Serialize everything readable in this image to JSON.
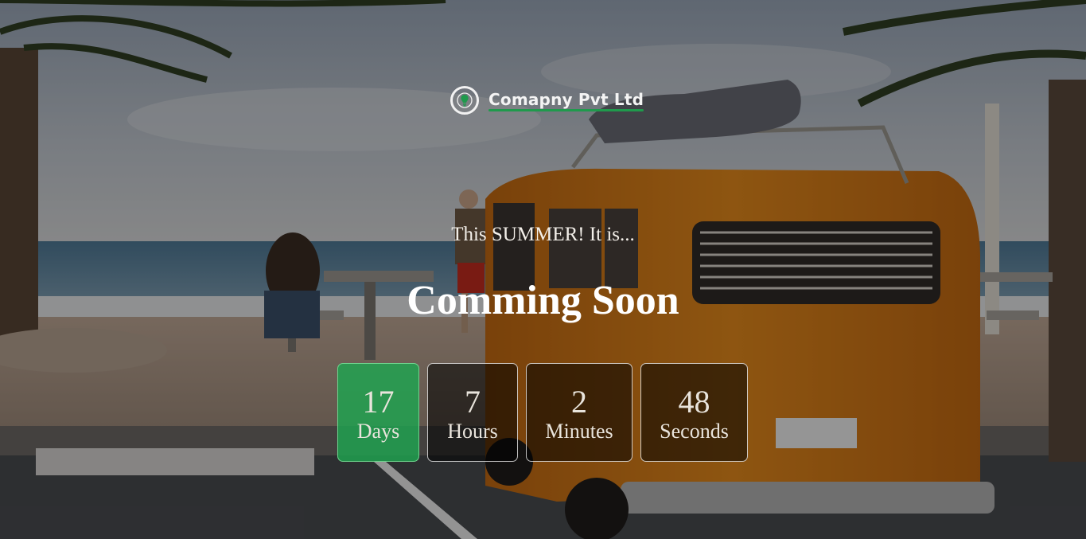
{
  "brand": {
    "name": "Comapny Pvt Ltd",
    "logo_icon": "lightbulb-icon",
    "accent_color": "#1f9a4c"
  },
  "hero": {
    "tagline": "This SUMMER! It is...",
    "headline": "Comming Soon"
  },
  "countdown": {
    "days": {
      "value": "17",
      "label": "Days"
    },
    "hours": {
      "value": "7",
      "label": "Hours"
    },
    "minutes": {
      "value": "2",
      "label": "Minutes"
    },
    "seconds": {
      "value": "48",
      "label": "Seconds"
    }
  },
  "background": {
    "subject": "orange-van-at-beach-photo"
  }
}
